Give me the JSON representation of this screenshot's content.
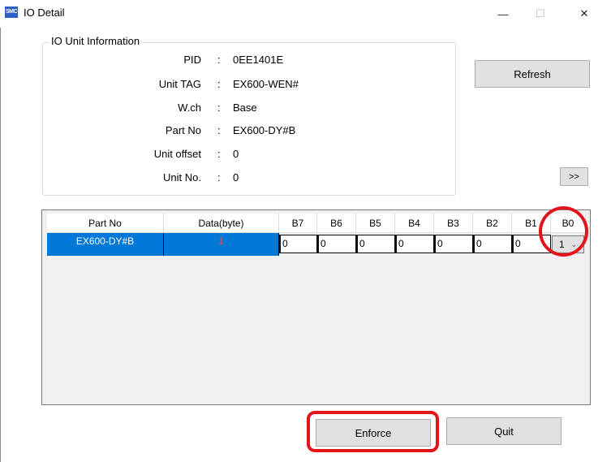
{
  "window": {
    "title": "IO Detail",
    "icon_text": "SMC",
    "minimize_glyph": "—",
    "maximize_glyph": "☐",
    "close_glyph": "✕"
  },
  "info": {
    "group_title": "IO Unit Information",
    "rows": [
      {
        "label": "PID",
        "value": "0EE1401E"
      },
      {
        "label": "Unit TAG",
        "value": "EX600-WEN#"
      },
      {
        "label": "W.ch",
        "value": "Base"
      },
      {
        "label": "Part No",
        "value": "EX600-DY#B"
      },
      {
        "label": "Unit offset",
        "value": "0"
      },
      {
        "label": "Unit No.",
        "value": "0"
      }
    ],
    "separator": ":"
  },
  "buttons": {
    "refresh": "Refresh",
    "expand": ">>",
    "enforce": "Enforce",
    "quit": "Quit"
  },
  "grid": {
    "columns": [
      "Part No",
      "Data(byte)",
      "B7",
      "B6",
      "B5",
      "B4",
      "B3",
      "B2",
      "B1",
      "B0"
    ],
    "row": {
      "part_no": "EX600-DY#B",
      "data_byte": "1",
      "b7": "0",
      "b6": "0",
      "b5": "0",
      "b4": "0",
      "b3": "0",
      "b2": "0",
      "b1": "0",
      "b0": "1"
    }
  },
  "colors": {
    "selection": "#0078d7",
    "annotation": "#e4141b",
    "data_value": "#e05050"
  },
  "icons": {
    "dropdown": "chevron-down-icon",
    "app": "smc-app-icon"
  }
}
